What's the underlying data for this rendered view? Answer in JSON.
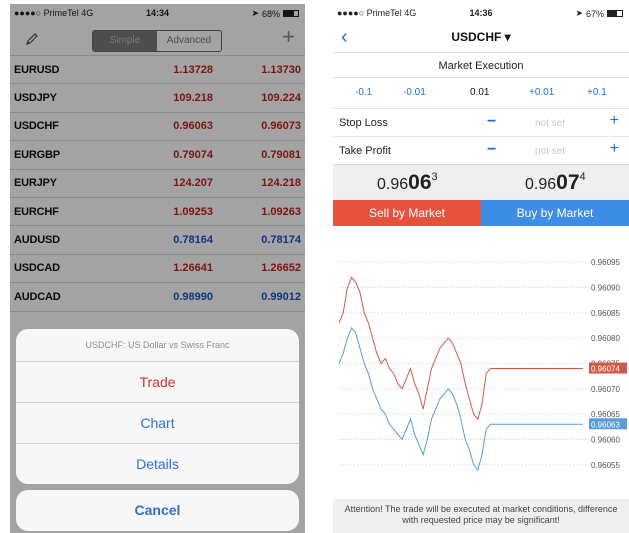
{
  "left": {
    "status": {
      "carrier": "●●●●○ PrimeTel  4G",
      "time": "14:34",
      "battery": "68%"
    },
    "toolbar": {
      "simple": "Simple",
      "advanced": "Advanced",
      "plus": "+"
    },
    "quotes": [
      {
        "symbol": "EURUSD",
        "bid": "1.13728",
        "ask": "1.13730",
        "bid_color": "red",
        "ask_color": "red"
      },
      {
        "symbol": "USDJPY",
        "bid": "109.218",
        "ask": "109.224",
        "bid_color": "red",
        "ask_color": "red"
      },
      {
        "symbol": "USDCHF",
        "bid": "0.96063",
        "ask": "0.96073",
        "bid_color": "red",
        "ask_color": "red"
      },
      {
        "symbol": "EURGBP",
        "bid": "0.79074",
        "ask": "0.79081",
        "bid_color": "red",
        "ask_color": "red"
      },
      {
        "symbol": "EURJPY",
        "bid": "124.207",
        "ask": "124.218",
        "bid_color": "red",
        "ask_color": "red"
      },
      {
        "symbol": "EURCHF",
        "bid": "1.09253",
        "ask": "1.09263",
        "bid_color": "red",
        "ask_color": "red"
      },
      {
        "symbol": "AUDUSD",
        "bid": "0.78164",
        "ask": "0.78174",
        "bid_color": "blue",
        "ask_color": "blue"
      },
      {
        "symbol": "USDCAD",
        "bid": "1.26641",
        "ask": "1.26652",
        "bid_color": "red",
        "ask_color": "red"
      },
      {
        "symbol": "AUDCAD",
        "bid": "0.98990",
        "ask": "0.99012",
        "bid_color": "blue",
        "ask_color": "blue"
      }
    ],
    "sheet": {
      "title": "USDCHF: US Dollar vs Swiss Franc",
      "items": [
        "Trade",
        "Chart",
        "Details"
      ],
      "cancel": "Cancel"
    }
  },
  "right": {
    "status": {
      "carrier": "●●●●○ PrimeTel  4G",
      "time": "14:36",
      "battery": "67%"
    },
    "nav": {
      "back": "‹",
      "title": "USDCHF ▾"
    },
    "execution": "Market Execution",
    "volume": {
      "dec_large": "-0.1",
      "dec_small": "-0.01",
      "current": "0.01",
      "inc_small": "+0.01",
      "inc_large": "+0.1"
    },
    "stop_loss": {
      "label": "Stop Loss",
      "value": "not set",
      "minus": "−",
      "plus": "+"
    },
    "take_profit": {
      "label": "Take Profit",
      "value": "not set",
      "minus": "−",
      "plus": "+"
    },
    "sell_price": {
      "prefix": "0.96",
      "big": "06",
      "sup": "3"
    },
    "buy_price": {
      "prefix": "0.96",
      "big": "07",
      "sup": "4"
    },
    "sell_button": "Sell by Market",
    "buy_button": "Buy by Market",
    "notice": "Attention! The trade will be executed at market conditions, difference with requested price may be significant!"
  },
  "colors": {
    "bid_red": "#c0261c",
    "blue": "#1b54c8",
    "sell": "#e5533e",
    "buy": "#3d8ce6",
    "accent": "#1f6fd6"
  },
  "chart_data": {
    "type": "line",
    "y_ticks": [
      "0.96095",
      "0.96090",
      "0.96085",
      "0.96080",
      "0.96075",
      "0.96070",
      "0.96065",
      "0.96060",
      "0.96055"
    ],
    "ylim": [
      0.96052,
      0.96097
    ],
    "ask_label": "0.96074",
    "bid_label": "0.96063",
    "series": [
      {
        "color": "#d25a45",
        "values": [
          0.96083,
          0.96085,
          0.9609,
          0.96092,
          0.96091,
          0.96089,
          0.96085,
          0.96083,
          0.9608,
          0.96077,
          0.96075,
          0.96076,
          0.96074,
          0.96073,
          0.96071,
          0.9607,
          0.96072,
          0.96074,
          0.96071,
          0.96069,
          0.96066,
          0.9607,
          0.96074,
          0.96076,
          0.96078,
          0.96079,
          0.9608,
          0.96079,
          0.96077,
          0.96075,
          0.96071,
          0.96068,
          0.96065,
          0.96064,
          0.96067,
          0.96073,
          0.96074,
          0.96074,
          0.96074,
          0.96074
        ]
      },
      {
        "color": "#5a9bd8",
        "values": [
          0.96075,
          0.96077,
          0.9608,
          0.96082,
          0.96081,
          0.96078,
          0.96075,
          0.96073,
          0.9607,
          0.96068,
          0.96066,
          0.96065,
          0.96063,
          0.96062,
          0.96061,
          0.9606,
          0.96062,
          0.96064,
          0.96061,
          0.96059,
          0.96057,
          0.9606,
          0.96064,
          0.96066,
          0.96068,
          0.96069,
          0.9607,
          0.96069,
          0.96067,
          0.96064,
          0.9606,
          0.96058,
          0.96055,
          0.96054,
          0.96057,
          0.96062,
          0.96063,
          0.96063,
          0.96063,
          0.96063
        ]
      }
    ]
  }
}
